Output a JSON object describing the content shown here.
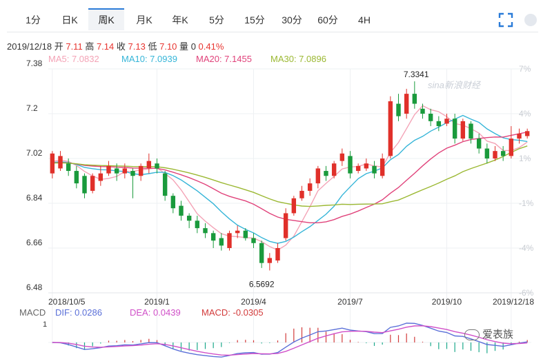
{
  "tabs": [
    {
      "label": "1分"
    },
    {
      "label": "日K"
    },
    {
      "label": "周K"
    },
    {
      "label": "月K"
    },
    {
      "label": "年K"
    },
    {
      "label": "5分"
    },
    {
      "label": "15分"
    },
    {
      "label": "30分"
    },
    {
      "label": "60分"
    },
    {
      "label": "4H"
    }
  ],
  "active_tab": "周K",
  "info": {
    "date": "2019/12/18",
    "open_label": "开",
    "open": "7.11",
    "high_label": "高",
    "high": "7.14",
    "close_label": "收",
    "close": "7.13",
    "low_label": "低",
    "low": "7.10",
    "vol_label": "量",
    "vol": "0",
    "change": "0.41%"
  },
  "ma_legend": [
    {
      "label": "MA5: 7.0832",
      "color": "#f4a3b6"
    },
    {
      "label": "MA10: 7.0939",
      "color": "#35b5d8"
    },
    {
      "label": "MA20: 7.1455",
      "color": "#e0427a"
    },
    {
      "label": "MA30: 7.0896",
      "color": "#9bb832"
    }
  ],
  "macd_legend": [
    {
      "label": "MACD",
      "color": "#666666"
    },
    {
      "label": "DIF: 0.0286",
      "color": "#5a6fd8"
    },
    {
      "label": "DEA: 0.0439",
      "color": "#d04fc8"
    },
    {
      "label": "MACD: -0.0305",
      "color": "#d23a3a"
    }
  ],
  "watermark": "sina新浪财经",
  "badge": "爱表族",
  "chart_data": {
    "type": "candlestick",
    "y_ticks": [
      "7.38",
      "7.2",
      "7.02",
      "6.84",
      "6.66",
      "6.48"
    ],
    "y_values": [
      7.38,
      7.2,
      7.02,
      6.84,
      6.66,
      6.48
    ],
    "pct_ticks": [
      "7%",
      "4%",
      "1%",
      "-1%",
      "-4%",
      "-6%"
    ],
    "x_labels": [
      "2018/10/5",
      "2019/1",
      "2019/4",
      "2019/7",
      "2019/10",
      "2019/12/18"
    ],
    "x_label_index": [
      0,
      13,
      25,
      37,
      49,
      57
    ],
    "max_label": "7.3341",
    "min_label": "6.5692",
    "ylim": [
      6.48,
      7.38
    ],
    "candles": [
      [
        6.96,
        7.04,
        6.94,
        7.05
      ],
      [
        6.98,
        7.03,
        6.97,
        7.05
      ],
      [
        7.0,
        6.97,
        6.95,
        7.02
      ],
      [
        6.97,
        6.92,
        6.9,
        6.99
      ],
      [
        6.95,
        6.88,
        6.86,
        6.96
      ],
      [
        6.89,
        6.95,
        6.88,
        6.96
      ],
      [
        6.93,
        6.96,
        6.91,
        6.99
      ],
      [
        6.96,
        6.99,
        6.95,
        7.01
      ],
      [
        6.98,
        6.96,
        6.93,
        7.0
      ],
      [
        6.96,
        6.98,
        6.94,
        7.0
      ],
      [
        6.97,
        6.95,
        6.86,
        6.98
      ],
      [
        6.95,
        6.99,
        6.93,
        7.0
      ],
      [
        6.98,
        7.01,
        6.96,
        7.04
      ],
      [
        7.0,
        6.98,
        6.96,
        7.02
      ],
      [
        6.96,
        6.87,
        6.85,
        6.97
      ],
      [
        6.87,
        6.82,
        6.8,
        6.88
      ],
      [
        6.83,
        6.79,
        6.77,
        6.85
      ],
      [
        6.79,
        6.77,
        6.74,
        6.8
      ],
      [
        6.77,
        6.74,
        6.72,
        6.79
      ],
      [
        6.74,
        6.72,
        6.7,
        6.76
      ],
      [
        6.72,
        6.69,
        6.66,
        6.73
      ],
      [
        6.7,
        6.67,
        6.65,
        6.72
      ],
      [
        6.66,
        6.72,
        6.65,
        6.73
      ],
      [
        6.72,
        6.73,
        6.7,
        6.75
      ],
      [
        6.73,
        6.7,
        6.69,
        6.74
      ],
      [
        6.7,
        6.68,
        6.66,
        6.72
      ],
      [
        6.68,
        6.6,
        6.58,
        6.69
      ],
      [
        6.6,
        6.62,
        6.57,
        6.64
      ],
      [
        6.61,
        6.66,
        6.6,
        6.68
      ],
      [
        6.7,
        6.8,
        6.69,
        6.82
      ],
      [
        6.8,
        6.86,
        6.79,
        6.87
      ],
      [
        6.86,
        6.89,
        6.85,
        6.91
      ],
      [
        6.89,
        6.92,
        6.87,
        6.94
      ],
      [
        6.92,
        6.98,
        6.9,
        6.99
      ],
      [
        6.97,
        6.95,
        6.93,
        6.99
      ],
      [
        6.95,
        7.0,
        6.94,
        7.01
      ],
      [
        7.01,
        7.04,
        6.99,
        7.06
      ],
      [
        7.03,
        6.96,
        6.94,
        7.05
      ],
      [
        6.97,
        6.99,
        6.96,
        7.0
      ],
      [
        6.98,
        7.0,
        6.97,
        7.02
      ],
      [
        6.99,
        6.96,
        6.94,
        7.01
      ],
      [
        6.95,
        7.02,
        6.94,
        7.04
      ],
      [
        7.03,
        7.25,
        7.02,
        7.27
      ],
      [
        7.24,
        7.19,
        7.17,
        7.28
      ],
      [
        7.2,
        7.28,
        7.18,
        7.3
      ],
      [
        7.28,
        7.24,
        7.22,
        7.33
      ],
      [
        7.22,
        7.2,
        7.18,
        7.24
      ],
      [
        7.2,
        7.17,
        7.15,
        7.22
      ],
      [
        7.17,
        7.15,
        7.13,
        7.19
      ],
      [
        7.16,
        7.18,
        7.15,
        7.2
      ],
      [
        7.18,
        7.1,
        7.08,
        7.2
      ],
      [
        7.1,
        7.17,
        7.09,
        7.18
      ],
      [
        7.16,
        7.1,
        7.08,
        7.17
      ],
      [
        7.1,
        7.06,
        7.04,
        7.12
      ],
      [
        7.06,
        7.02,
        7.0,
        7.08
      ],
      [
        7.02,
        7.05,
        7.01,
        7.07
      ],
      [
        7.05,
        7.03,
        7.01,
        7.07
      ],
      [
        7.03,
        7.1,
        7.02,
        7.15
      ],
      [
        7.1,
        7.12,
        7.08,
        7.14
      ],
      [
        7.11,
        7.13,
        7.1,
        7.14
      ]
    ]
  }
}
